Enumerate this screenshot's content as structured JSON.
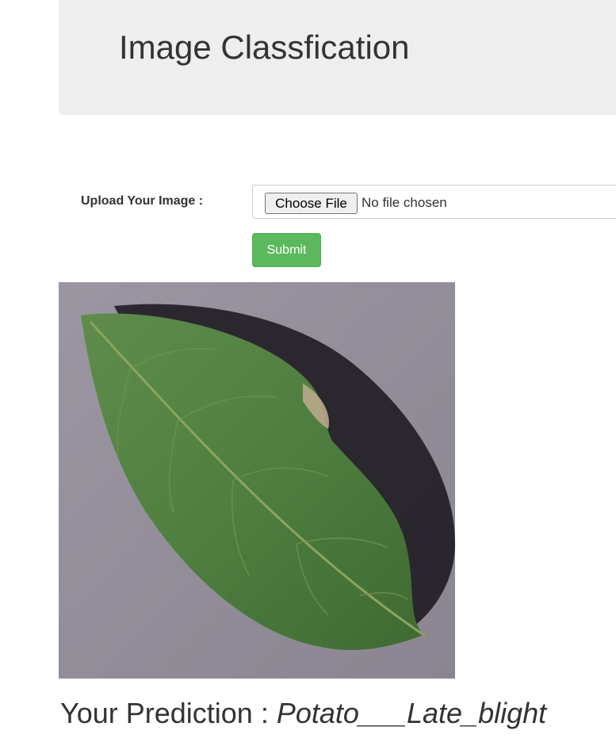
{
  "header": {
    "title": "Image Classfication"
  },
  "upload_form": {
    "label": "Upload Your Image :",
    "choose_file_label": "Choose File",
    "file_status": "No file chosen",
    "submit_label": "Submit"
  },
  "result": {
    "prediction_label": "Your Prediction :",
    "prediction_value": "Potato___Late_blight"
  },
  "colors": {
    "jumbotron_bg": "#eeeeee",
    "submit_bg": "#5cb85c",
    "leaf_green": "#4e7d3f"
  }
}
